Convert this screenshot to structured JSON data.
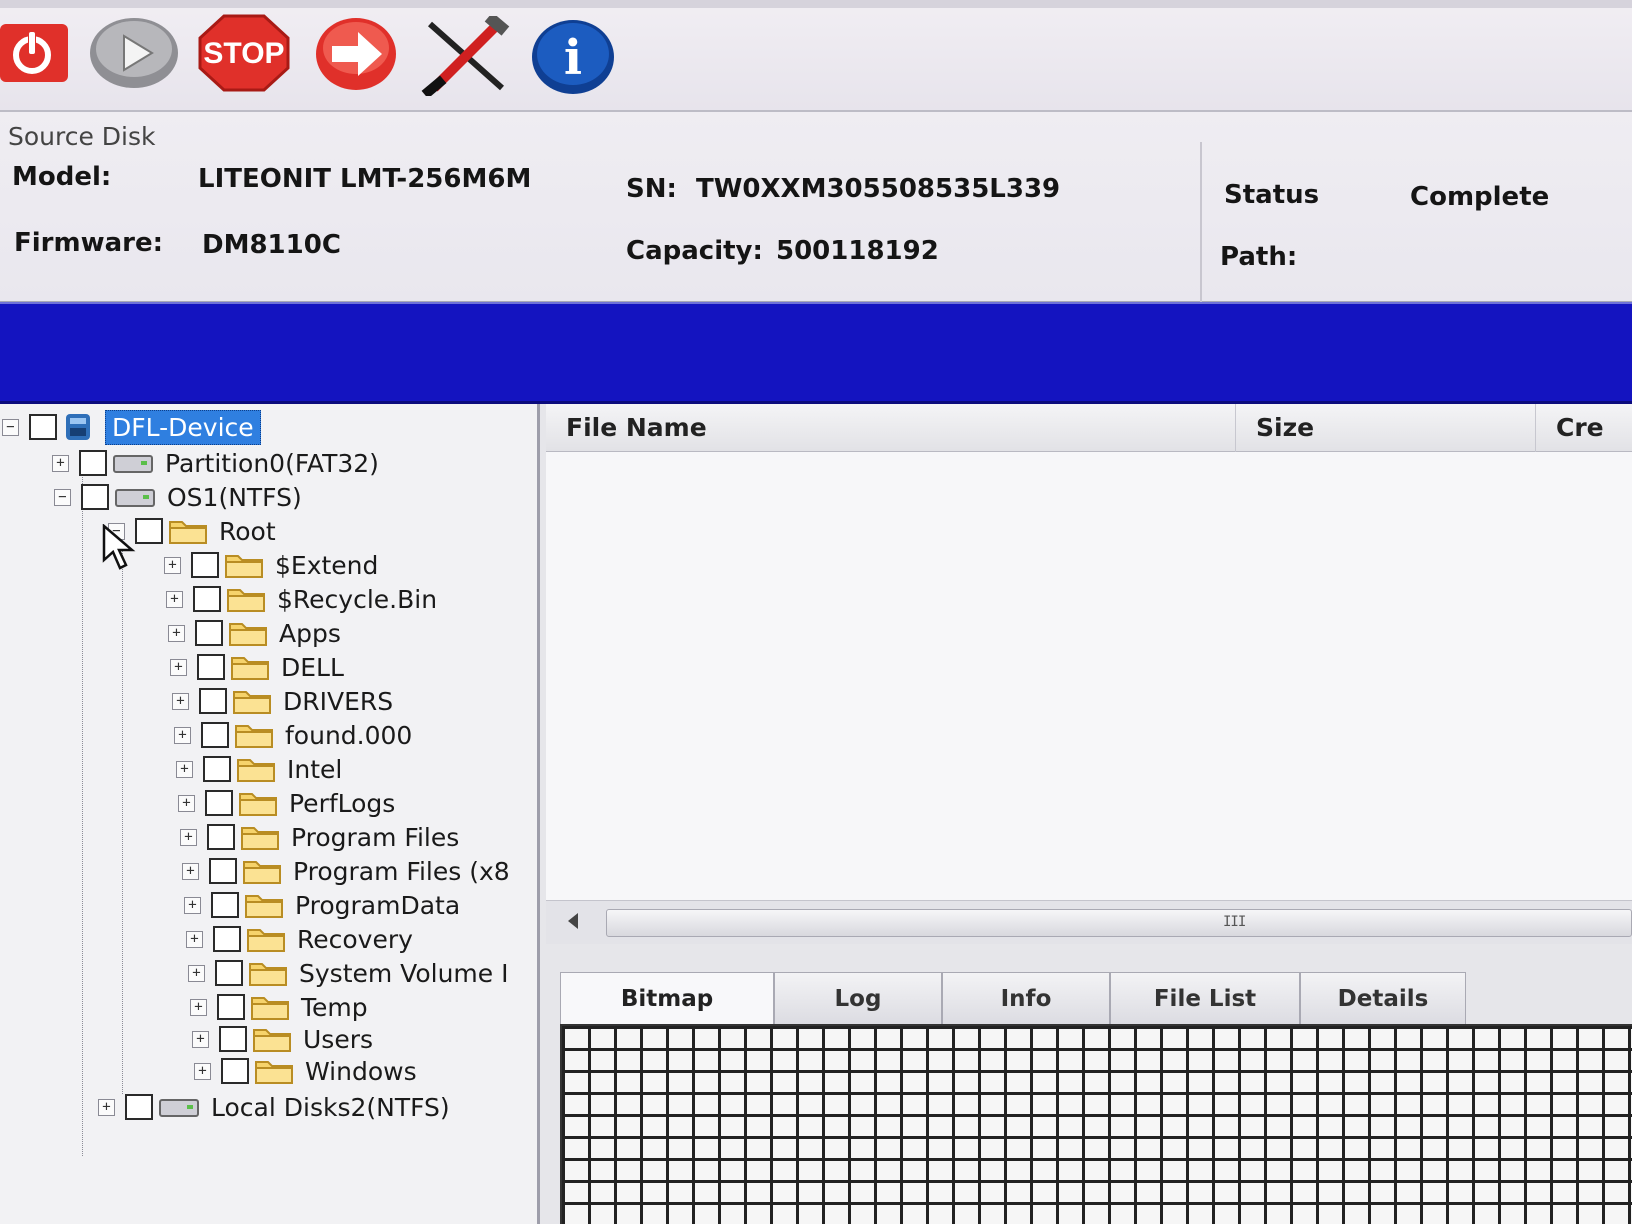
{
  "toolbar": {
    "buttons": [
      {
        "name": "power",
        "icon": "power-icon",
        "color": "#e0302a"
      },
      {
        "name": "play",
        "icon": "play-icon",
        "color": "#9a9a9a"
      },
      {
        "name": "stop",
        "icon": "stop-icon",
        "label": "STOP",
        "color": "#e0302a"
      },
      {
        "name": "next",
        "icon": "arrow-right-icon",
        "color": "#e0302a"
      },
      {
        "name": "tools",
        "icon": "tools-icon",
        "color": "#d02020"
      },
      {
        "name": "info",
        "icon": "info-icon",
        "label": "i",
        "color": "#1c5cc0"
      }
    ]
  },
  "source_disk": {
    "group_label": "Source Disk",
    "model_label": "Model:",
    "model_value": "LITEONIT LMT-256M6M",
    "sn_label": "SN:",
    "sn_value": "TW0XXM305508535L339",
    "firmware_label": "Firmware:",
    "firmware_value": "DM8110C",
    "capacity_label": "Capacity:",
    "capacity_value": "500118192",
    "status_label": "Status",
    "status_value": "Complete",
    "path_label": "Path:"
  },
  "progress": {
    "percent": 100,
    "color": "#1414c0"
  },
  "tree": {
    "root": {
      "label": "DFL-Device"
    },
    "partition0": {
      "label": "Partition0(FAT32)"
    },
    "os1": {
      "label": "OS1(NTFS)"
    },
    "root_folder": {
      "label": "Root"
    },
    "folders": [
      "$Extend",
      "$Recycle.Bin",
      "Apps",
      "DELL",
      "DRIVERS",
      "found.000",
      "Intel",
      "PerfLogs",
      "Program Files",
      "Program Files (x8",
      "ProgramData",
      "Recovery",
      "System Volume I",
      "Temp",
      "Users",
      "Windows"
    ],
    "local_disks": {
      "label": "Local Disks2(NTFS)"
    }
  },
  "file_list": {
    "columns": {
      "file_name": "File Name",
      "size": "Size",
      "created": "Cre"
    },
    "scroll_grip": "III"
  },
  "tabs": {
    "bitmap": "Bitmap",
    "log": "Log",
    "info": "Info",
    "file_list": "File List",
    "details": "Details"
  }
}
